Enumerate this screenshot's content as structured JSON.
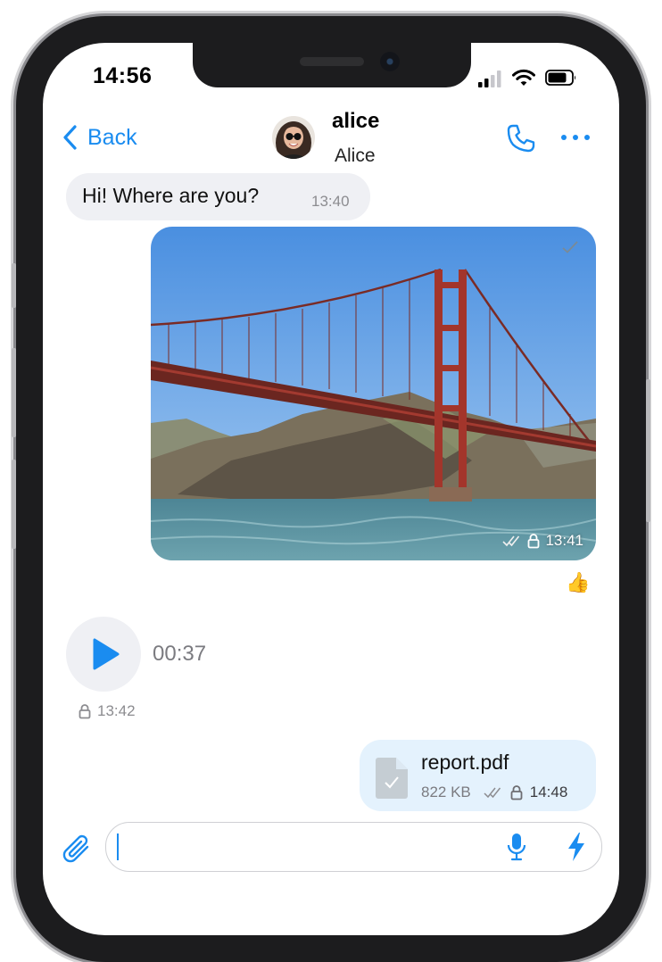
{
  "status_bar": {
    "time": "14:56",
    "icons": [
      "cellular-signal-icon",
      "wifi-icon",
      "battery-icon"
    ]
  },
  "header": {
    "back_label": "Back",
    "contact_username": "alice",
    "contact_name": "Alice",
    "actions": [
      "phone-icon",
      "more-icon"
    ]
  },
  "messages": [
    {
      "type": "text",
      "direction": "incoming",
      "text": "Hi! Where are you?",
      "time": "13:40"
    },
    {
      "type": "photo",
      "direction": "outgoing",
      "time": "13:41",
      "status": "read",
      "reaction": "👍"
    },
    {
      "type": "voice",
      "direction": "incoming",
      "duration": "00:37",
      "time": "13:42"
    },
    {
      "type": "file",
      "direction": "outgoing",
      "file_name": "report.pdf",
      "file_size": "822 KB",
      "time": "14:48",
      "status": "read"
    }
  ],
  "composer": {
    "input_value": "",
    "icons": [
      "paperclip-icon",
      "microphone-icon",
      "lightning-icon"
    ]
  },
  "colors": {
    "accent": "#1a8cf0",
    "incoming_bubble": "#eff0f4",
    "outgoing_file_bubble": "#e4f2fd",
    "timestamp": "#8c8c90"
  }
}
